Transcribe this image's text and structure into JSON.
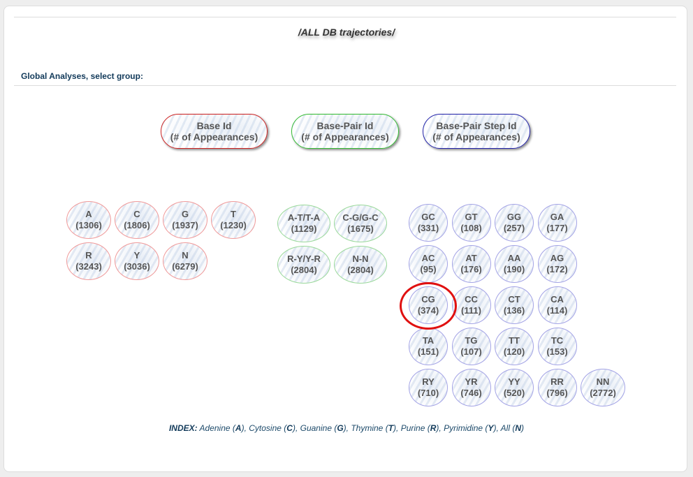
{
  "page": {
    "title": "/ALL DB trajectories/",
    "section_label": "Global Analyses, select group:"
  },
  "groups": [
    {
      "line1": "Base Id",
      "line2": "(# of Appearances)"
    },
    {
      "line1": "Base-Pair Id",
      "line2": "(# of Appearances)"
    },
    {
      "line1": "Base-Pair Step Id",
      "line2": "(# of Appearances)"
    }
  ],
  "bases": [
    {
      "label": "A",
      "count": "(1306)"
    },
    {
      "label": "C",
      "count": "(1806)"
    },
    {
      "label": "G",
      "count": "(1937)"
    },
    {
      "label": "T",
      "count": "(1230)"
    },
    {
      "label": "R",
      "count": "(3243)"
    },
    {
      "label": "Y",
      "count": "(3036)"
    },
    {
      "label": "N",
      "count": "(6279)"
    }
  ],
  "base_pairs": [
    {
      "label": "A-T/T-A",
      "count": "(1129)"
    },
    {
      "label": "C-G/G-C",
      "count": "(1675)"
    },
    {
      "label": "R-Y/Y-R",
      "count": "(2804)"
    },
    {
      "label": "N-N",
      "count": "(2804)"
    }
  ],
  "steps": [
    {
      "label": "GC",
      "count": "(331)"
    },
    {
      "label": "GT",
      "count": "(108)"
    },
    {
      "label": "GG",
      "count": "(257)"
    },
    {
      "label": "GA",
      "count": "(177)"
    },
    {
      "label": "AC",
      "count": "(95)"
    },
    {
      "label": "AT",
      "count": "(176)"
    },
    {
      "label": "AA",
      "count": "(190)"
    },
    {
      "label": "AG",
      "count": "(172)"
    },
    {
      "label": "CG",
      "count": "(374)"
    },
    {
      "label": "CC",
      "count": "(111)"
    },
    {
      "label": "CT",
      "count": "(136)"
    },
    {
      "label": "CA",
      "count": "(114)"
    },
    {
      "label": "TA",
      "count": "(151)"
    },
    {
      "label": "TG",
      "count": "(107)"
    },
    {
      "label": "TT",
      "count": "(120)"
    },
    {
      "label": "TC",
      "count": "(153)"
    },
    {
      "label": "RY",
      "count": "(710)"
    },
    {
      "label": "YR",
      "count": "(746)"
    },
    {
      "label": "YY",
      "count": "(520)"
    },
    {
      "label": "RR",
      "count": "(796)"
    },
    {
      "label": "NN",
      "count": "(2772)"
    }
  ],
  "index": {
    "prefix": "INDEX:",
    "items": [
      {
        "name": "Adenine",
        "code": "A"
      },
      {
        "name": "Cytosine",
        "code": "C"
      },
      {
        "name": "Guanine",
        "code": "G"
      },
      {
        "name": "Thymine",
        "code": "T"
      },
      {
        "name": "Purine",
        "code": "R"
      },
      {
        "name": "Pyrimidine",
        "code": "Y"
      },
      {
        "name": "All",
        "code": "N"
      }
    ]
  },
  "colors": {
    "base": "#cc2222",
    "base_pair": "#33bb33",
    "step": "#2222aa",
    "highlight": "#e01010"
  }
}
